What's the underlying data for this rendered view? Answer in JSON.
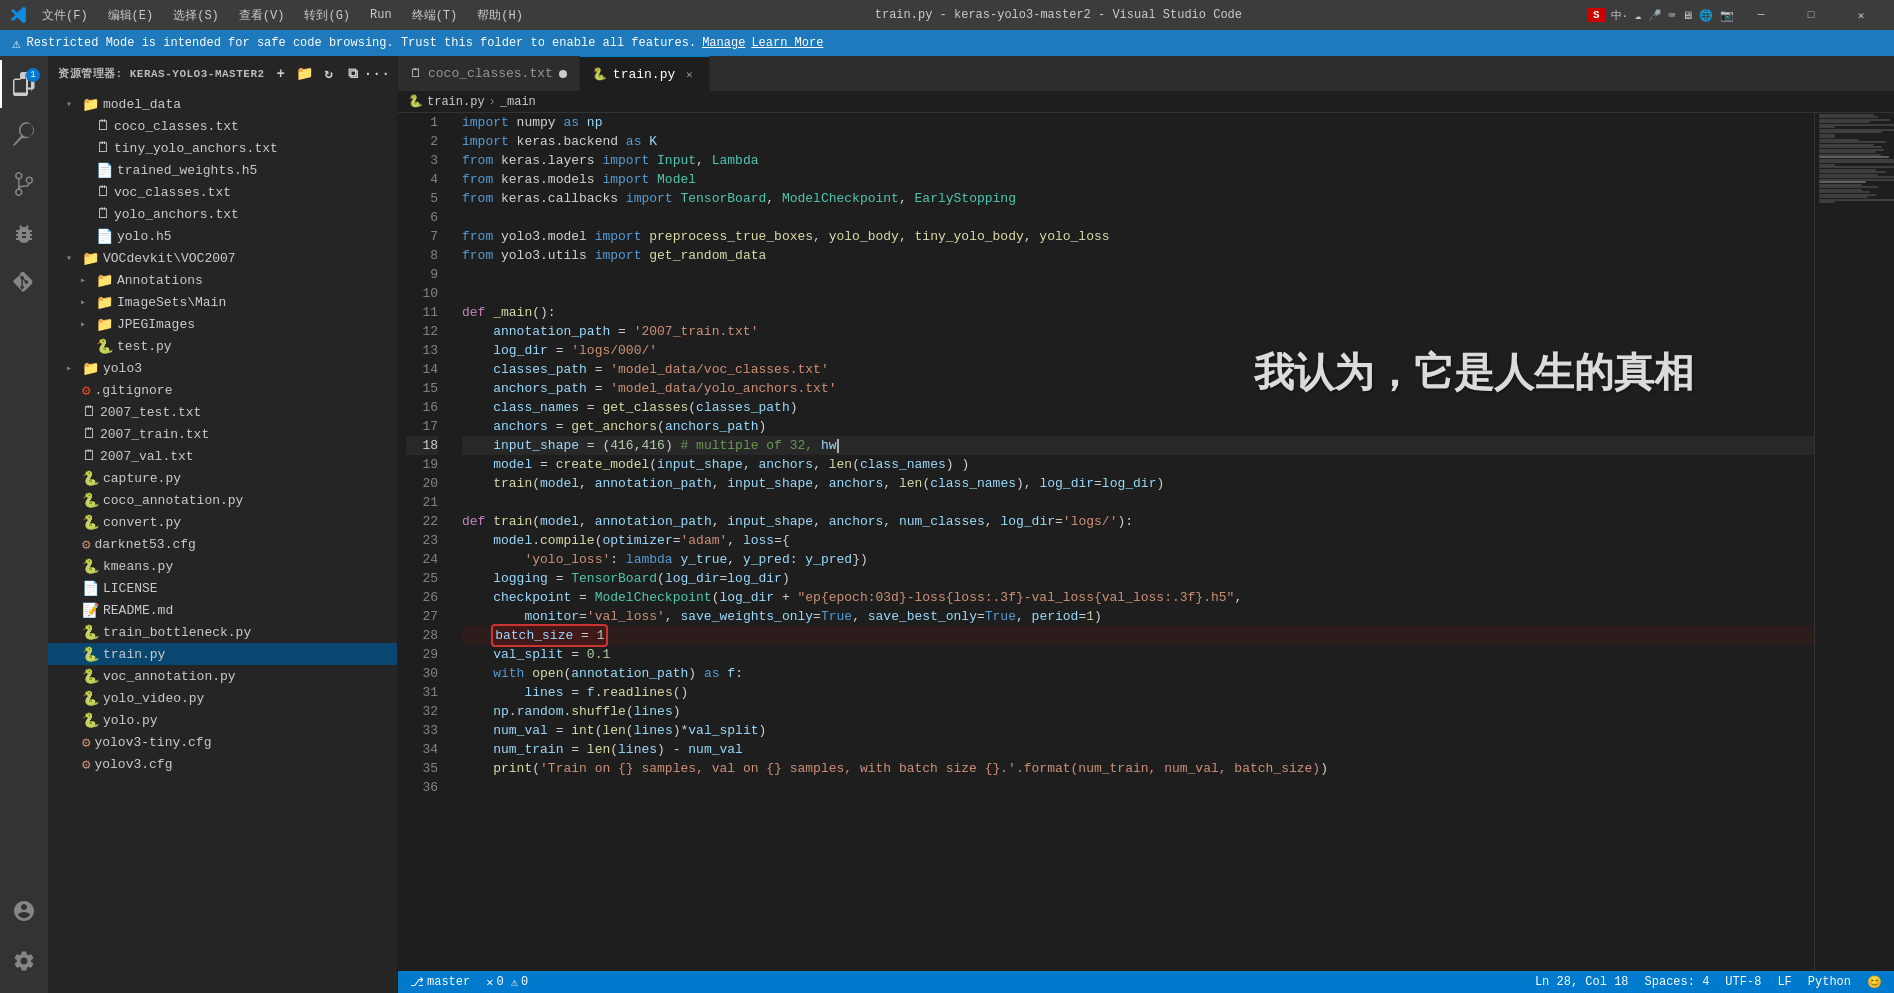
{
  "window": {
    "title": "train.py - keras-yolo3-master2 - Visual Studio Code",
    "menu_items": [
      "文件(F)",
      "编辑(E)",
      "选择(S)",
      "查看(V)",
      "转到(G)",
      "Run",
      "终端(T)",
      "帮助(H)"
    ]
  },
  "notification": {
    "text": "Restricted Mode is intended for safe code browsing. Trust this folder to enable all features.",
    "manage_label": "Manage",
    "learn_more_label": "Learn More"
  },
  "sidebar": {
    "title": "资源管理器: KERAS-YOLO3-MASTER2",
    "files": [
      {
        "name": "model_data",
        "type": "folder",
        "expanded": true,
        "indent": 1
      },
      {
        "name": "coco_classes.txt",
        "type": "txt",
        "indent": 2
      },
      {
        "name": "tiny_yolo_anchors.txt",
        "type": "txt",
        "indent": 2
      },
      {
        "name": "trained_weights.h5",
        "type": "h5",
        "indent": 2
      },
      {
        "name": "voc_classes.txt",
        "type": "txt",
        "indent": 2
      },
      {
        "name": "yolo_anchors.txt",
        "type": "txt",
        "indent": 2
      },
      {
        "name": "yolo.h5",
        "type": "h5",
        "indent": 2
      },
      {
        "name": "VOCdevkit\\VOC2007",
        "type": "folder",
        "expanded": true,
        "indent": 1
      },
      {
        "name": "Annotations",
        "type": "folder",
        "expanded": false,
        "indent": 2
      },
      {
        "name": "ImageSets\\Main",
        "type": "folder",
        "expanded": false,
        "indent": 2
      },
      {
        "name": "JPEGImages",
        "type": "folder",
        "expanded": false,
        "indent": 2
      },
      {
        "name": "test.py",
        "type": "py",
        "indent": 2
      },
      {
        "name": "yolo3",
        "type": "folder",
        "expanded": false,
        "indent": 1
      },
      {
        "name": ".gitignore",
        "type": "git",
        "indent": 1
      },
      {
        "name": "2007_test.txt",
        "type": "txt",
        "indent": 1
      },
      {
        "name": "2007_train.txt",
        "type": "txt",
        "indent": 1
      },
      {
        "name": "2007_val.txt",
        "type": "txt",
        "indent": 1
      },
      {
        "name": "capture.py",
        "type": "py",
        "indent": 1
      },
      {
        "name": "coco_annotation.py",
        "type": "py",
        "indent": 1
      },
      {
        "name": "convert.py",
        "type": "py",
        "indent": 1
      },
      {
        "name": "darknet53.cfg",
        "type": "cfg",
        "indent": 1
      },
      {
        "name": "kmeans.py",
        "type": "py",
        "indent": 1
      },
      {
        "name": "LICENSE",
        "type": "license",
        "indent": 1
      },
      {
        "name": "README.md",
        "type": "md",
        "indent": 1
      },
      {
        "name": "train_bottleneck.py",
        "type": "py",
        "indent": 1
      },
      {
        "name": "train.py",
        "type": "py",
        "indent": 1,
        "selected": true
      },
      {
        "name": "voc_annotation.py",
        "type": "py",
        "indent": 1
      },
      {
        "name": "yolo_video.py",
        "type": "py",
        "indent": 1
      },
      {
        "name": "yolo.py",
        "type": "py",
        "indent": 1
      },
      {
        "name": "yolov3-tiny.cfg",
        "type": "cfg",
        "indent": 1
      },
      {
        "name": "yolov3.cfg",
        "type": "cfg",
        "indent": 1
      }
    ]
  },
  "tabs": [
    {
      "name": "coco_classes.txt",
      "type": "txt",
      "active": false,
      "modified": true
    },
    {
      "name": "train.py",
      "type": "py",
      "active": true,
      "modified": false
    }
  ],
  "breadcrumb": {
    "parts": [
      "train.py",
      "_main"
    ]
  },
  "code": {
    "filename": "train.py",
    "lines": [
      {
        "n": 1,
        "text": "import numpy as np"
      },
      {
        "n": 2,
        "text": "import keras.backend as K"
      },
      {
        "n": 3,
        "text": "from keras.layers import Input, Lambda"
      },
      {
        "n": 4,
        "text": "from keras.models import Model"
      },
      {
        "n": 5,
        "text": "from keras.callbacks import TensorBoard, ModelCheckpoint, EarlyStopping"
      },
      {
        "n": 6,
        "text": ""
      },
      {
        "n": 7,
        "text": "from yolo3.model import preprocess_true_boxes, yolo_body, tiny_yolo_body, yolo_loss"
      },
      {
        "n": 8,
        "text": "from yolo3.utils import get_random_data"
      },
      {
        "n": 9,
        "text": ""
      },
      {
        "n": 10,
        "text": ""
      },
      {
        "n": 11,
        "text": "def _main():"
      },
      {
        "n": 12,
        "text": "    annotation_path = '2007_train.txt'"
      },
      {
        "n": 13,
        "text": "    log_dir = 'logs/000/'"
      },
      {
        "n": 14,
        "text": "    classes_path = 'model_data/voc_classes.txt'"
      },
      {
        "n": 15,
        "text": "    anchors_path = 'model_data/yolo_anchors.txt'"
      },
      {
        "n": 16,
        "text": "    class_names = get_classes(classes_path)"
      },
      {
        "n": 17,
        "text": "    anchors = get_anchors(anchors_path)"
      },
      {
        "n": 18,
        "text": "    input_shape = (416,416) # multiple of 32, hw"
      },
      {
        "n": 19,
        "text": "    model = create_model(input_shape, anchors, len(class_names) )"
      },
      {
        "n": 20,
        "text": "    train(model, annotation_path, input_shape, anchors, len(class_names), log_dir=log_dir)"
      },
      {
        "n": 21,
        "text": ""
      },
      {
        "n": 22,
        "text": "def train(model, annotation_path, input_shape, anchors, num_classes, log_dir='logs/'):"
      },
      {
        "n": 23,
        "text": "    model.compile(optimizer='adam', loss={"
      },
      {
        "n": 24,
        "text": "        'yolo_loss': lambda y_true, y_pred: y_pred})"
      },
      {
        "n": 25,
        "text": "    logging = TensorBoard(log_dir=log_dir)"
      },
      {
        "n": 26,
        "text": "    checkpoint = ModelCheckpoint(log_dir + \"ep{epoch:03d}-loss{loss:.3f}-val_loss{val_loss:.3f}.h5\","
      },
      {
        "n": 27,
        "text": "        monitor='val_loss', save_weights_only=True, save_best_only=True, period=1)"
      },
      {
        "n": 28,
        "text": "    batch_size = 1",
        "highlight": true
      },
      {
        "n": 29,
        "text": "    val_split = 0.1"
      },
      {
        "n": 30,
        "text": "    with open(annotation_path) as f:"
      },
      {
        "n": 31,
        "text": "        lines = f.readlines()"
      },
      {
        "n": 32,
        "text": "    np.random.shuffle(lines)"
      },
      {
        "n": 33,
        "text": "    num_val = int(len(lines)*val_split)"
      },
      {
        "n": 34,
        "text": "    num_train = len(lines) - num_val"
      },
      {
        "n": 35,
        "text": "    print('Train on {} samples, val on {} samples, with batch size {}.'.format(num_train, num_val, batch_size))"
      },
      {
        "n": 36,
        "text": ""
      }
    ]
  },
  "overlay": {
    "chinese_text": "我认为，它是人生的真相"
  },
  "status_bar": {
    "branch": "master",
    "errors": "0",
    "warnings": "0",
    "line_col": "Ln 28, Col 18",
    "spaces": "Spaces: 4",
    "encoding": "UTF-8",
    "line_ending": "LF",
    "language": "Python",
    "feedback": "😊"
  }
}
